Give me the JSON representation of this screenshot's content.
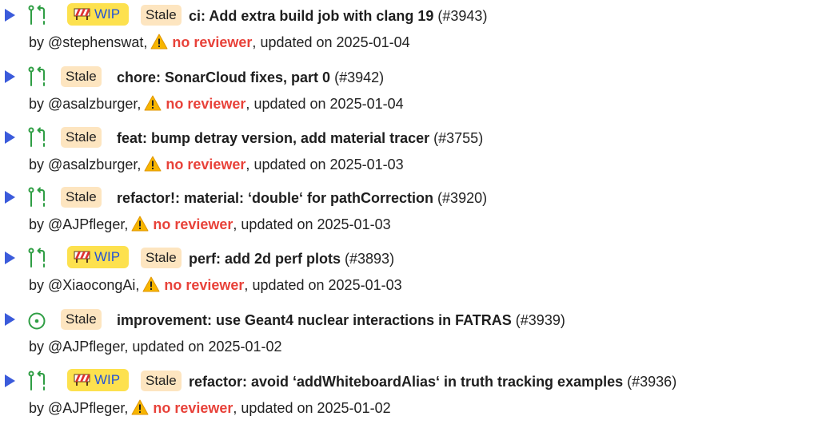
{
  "colors": {
    "arrow": "#3b5bdb",
    "icon": "#2f9e44",
    "wip_bg": "#fde14e",
    "wip_text": "#2453d6",
    "stale_bg": "#fde5c0",
    "no_reviewer": "#e8423a",
    "warning_icon": "#f7b500"
  },
  "icons": {
    "expand": "play-arrow-icon",
    "pr": "pull-request-icon",
    "issue": "issue-open-icon",
    "wip": "construction-barrier-icon",
    "warning": "warning-triangle-icon"
  },
  "labels": {
    "wip": "WIP",
    "stale": "Stale",
    "no_reviewer": "no reviewer",
    "by": "by ",
    "updated_on": "updated on "
  },
  "prs": [
    {
      "kind": "pr",
      "wip": true,
      "title": "ci: Add extra build job with clang 19",
      "number": "#3943",
      "author": "@stephenswat",
      "no_reviewer": true,
      "updated": "2025-01-04"
    },
    {
      "kind": "pr",
      "wip": false,
      "title": "chore: SonarCloud fixes, part 0",
      "number": "#3942",
      "author": "@asalzburger",
      "no_reviewer": true,
      "updated": "2025-01-04"
    },
    {
      "kind": "pr",
      "wip": false,
      "title": "feat: bump detray version, add material tracer",
      "number": "#3755",
      "author": "@asalzburger",
      "no_reviewer": true,
      "updated": "2025-01-03"
    },
    {
      "kind": "pr",
      "wip": false,
      "title": "refactor!: material: ‘double‘ for pathCorrection",
      "number": "#3920",
      "author": "@AJPfleger",
      "no_reviewer": true,
      "updated": "2025-01-03"
    },
    {
      "kind": "pr",
      "wip": true,
      "title": "perf: add 2d perf plots",
      "number": "#3893",
      "author": "@XiaocongAi",
      "no_reviewer": true,
      "updated": "2025-01-03"
    },
    {
      "kind": "issue",
      "wip": false,
      "title": "improvement: use Geant4 nuclear interactions in FATRAS",
      "number": "#3939",
      "author": "@AJPfleger",
      "no_reviewer": false,
      "updated": "2025-01-02"
    },
    {
      "kind": "pr",
      "wip": true,
      "title": "refactor: avoid ‘addWhiteboardAlias‘ in truth tracking examples",
      "number": "#3936",
      "author": "@AJPfleger",
      "no_reviewer": true,
      "updated": "2025-01-02"
    }
  ]
}
